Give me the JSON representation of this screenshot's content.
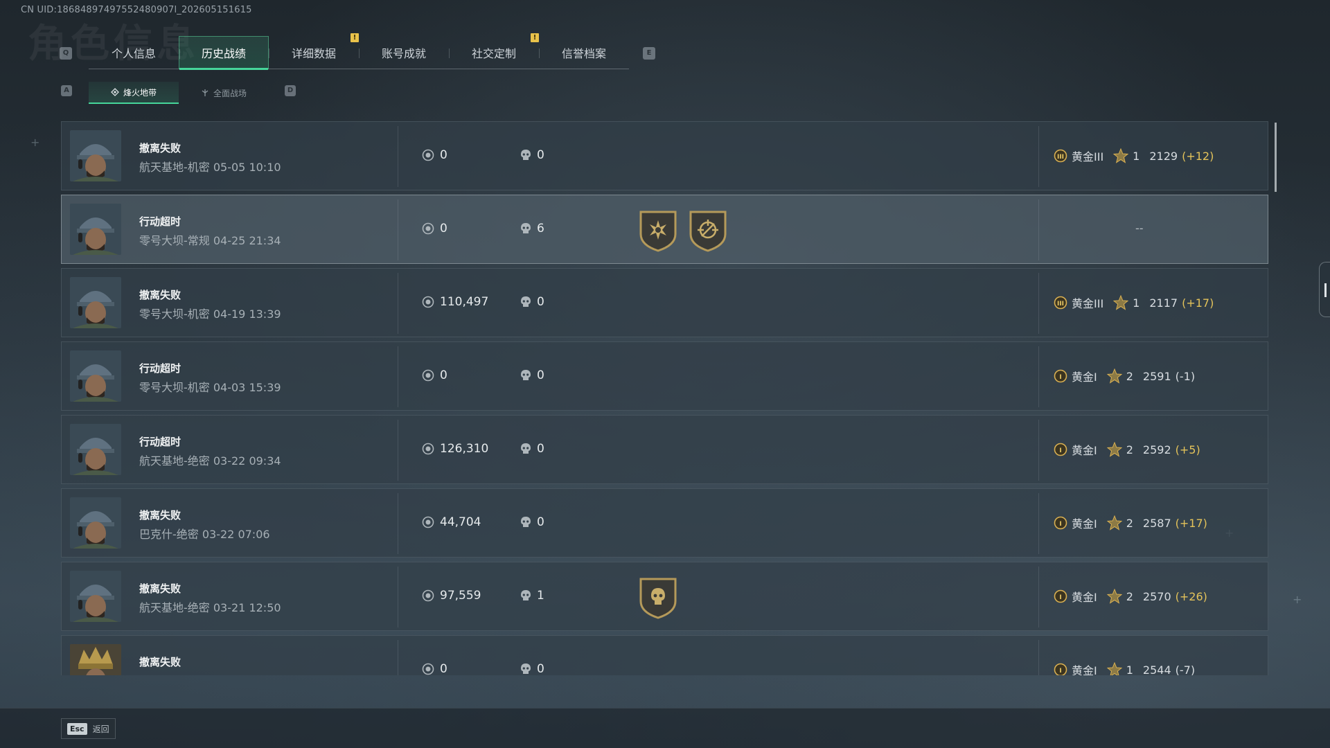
{
  "uid": "CN UID:18684897497552480907l_202605151615",
  "background_title": "角色信息",
  "keys": {
    "prev_tab": "Q",
    "next_tab": "E",
    "prev_sub": "A",
    "next_sub": "D"
  },
  "tabs": [
    {
      "label": "个人信息",
      "active": false,
      "badge": ""
    },
    {
      "label": "历史战绩",
      "active": true,
      "badge": ""
    },
    {
      "label": "详细数据",
      "active": false,
      "badge": "!"
    },
    {
      "label": "账号成就",
      "active": false,
      "badge": ""
    },
    {
      "label": "社交定制",
      "active": false,
      "badge": "!"
    },
    {
      "label": "信誉档案",
      "active": false,
      "badge": ""
    }
  ],
  "subtabs": [
    {
      "label": "烽火地带",
      "icon": "flame-zone-icon",
      "active": true
    },
    {
      "label": "全面战场",
      "icon": "battlefield-icon",
      "active": false
    }
  ],
  "records": [
    {
      "status": "撤离失败",
      "map": "航天基地-机密 05-05 10:10",
      "coins": "0",
      "kills": "0",
      "badges": [],
      "tier": "黄金III",
      "tier_icon": "III",
      "stars": "1",
      "score": "2129",
      "delta": "(+12)",
      "avatar": "soldier"
    },
    {
      "status": "行动超时",
      "map": "零号大坝-常规 04-25 21:34",
      "coins": "0",
      "kills": "6",
      "badges": [
        "sunburst-badge-icon",
        "crosshair-badge-icon"
      ],
      "tier": "",
      "tier_icon": "",
      "stars": "",
      "score": "",
      "delta": "",
      "dash": "--",
      "avatar": "soldier"
    },
    {
      "status": "撤离失败",
      "map": "零号大坝-机密 04-19 13:39",
      "coins": "110,497",
      "kills": "0",
      "badges": [],
      "tier": "黄金III",
      "tier_icon": "III",
      "stars": "1",
      "score": "2117",
      "delta": "(+17)",
      "avatar": "soldier"
    },
    {
      "status": "行动超时",
      "map": "零号大坝-机密 04-03 15:39",
      "coins": "0",
      "kills": "0",
      "badges": [],
      "tier": "黄金I",
      "tier_icon": "I",
      "stars": "2",
      "score": "2591",
      "delta": "(-1)",
      "avatar": "soldier"
    },
    {
      "status": "行动超时",
      "map": "航天基地-绝密 03-22 09:34",
      "coins": "126,310",
      "kills": "0",
      "badges": [],
      "tier": "黄金I",
      "tier_icon": "I",
      "stars": "2",
      "score": "2592",
      "delta": "(+5)",
      "avatar": "soldier"
    },
    {
      "status": "撤离失败",
      "map": "巴克什-绝密 03-22 07:06",
      "coins": "44,704",
      "kills": "0",
      "badges": [],
      "tier": "黄金I",
      "tier_icon": "I",
      "stars": "2",
      "score": "2587",
      "delta": "(+17)",
      "avatar": "soldier"
    },
    {
      "status": "撤离失败",
      "map": "航天基地-绝密 03-21 12:50",
      "coins": "97,559",
      "kills": "1",
      "badges": [
        "skull-badge-icon"
      ],
      "tier": "黄金I",
      "tier_icon": "I",
      "stars": "2",
      "score": "2570",
      "delta": "(+26)",
      "avatar": "soldier"
    },
    {
      "status": "撤离失败",
      "map": "",
      "coins": "0",
      "kills": "0",
      "badges": [],
      "tier": "黄金I",
      "tier_icon": "I",
      "stars": "1",
      "score": "2544",
      "delta": "(-7)",
      "avatar": "warrior"
    }
  ],
  "footer": {
    "esc_key": "Esc",
    "back_label": "返回"
  },
  "colors": {
    "accent_green": "#46d69a",
    "gold": "#e4c35a",
    "badge_yellow": "#e8c24a"
  }
}
